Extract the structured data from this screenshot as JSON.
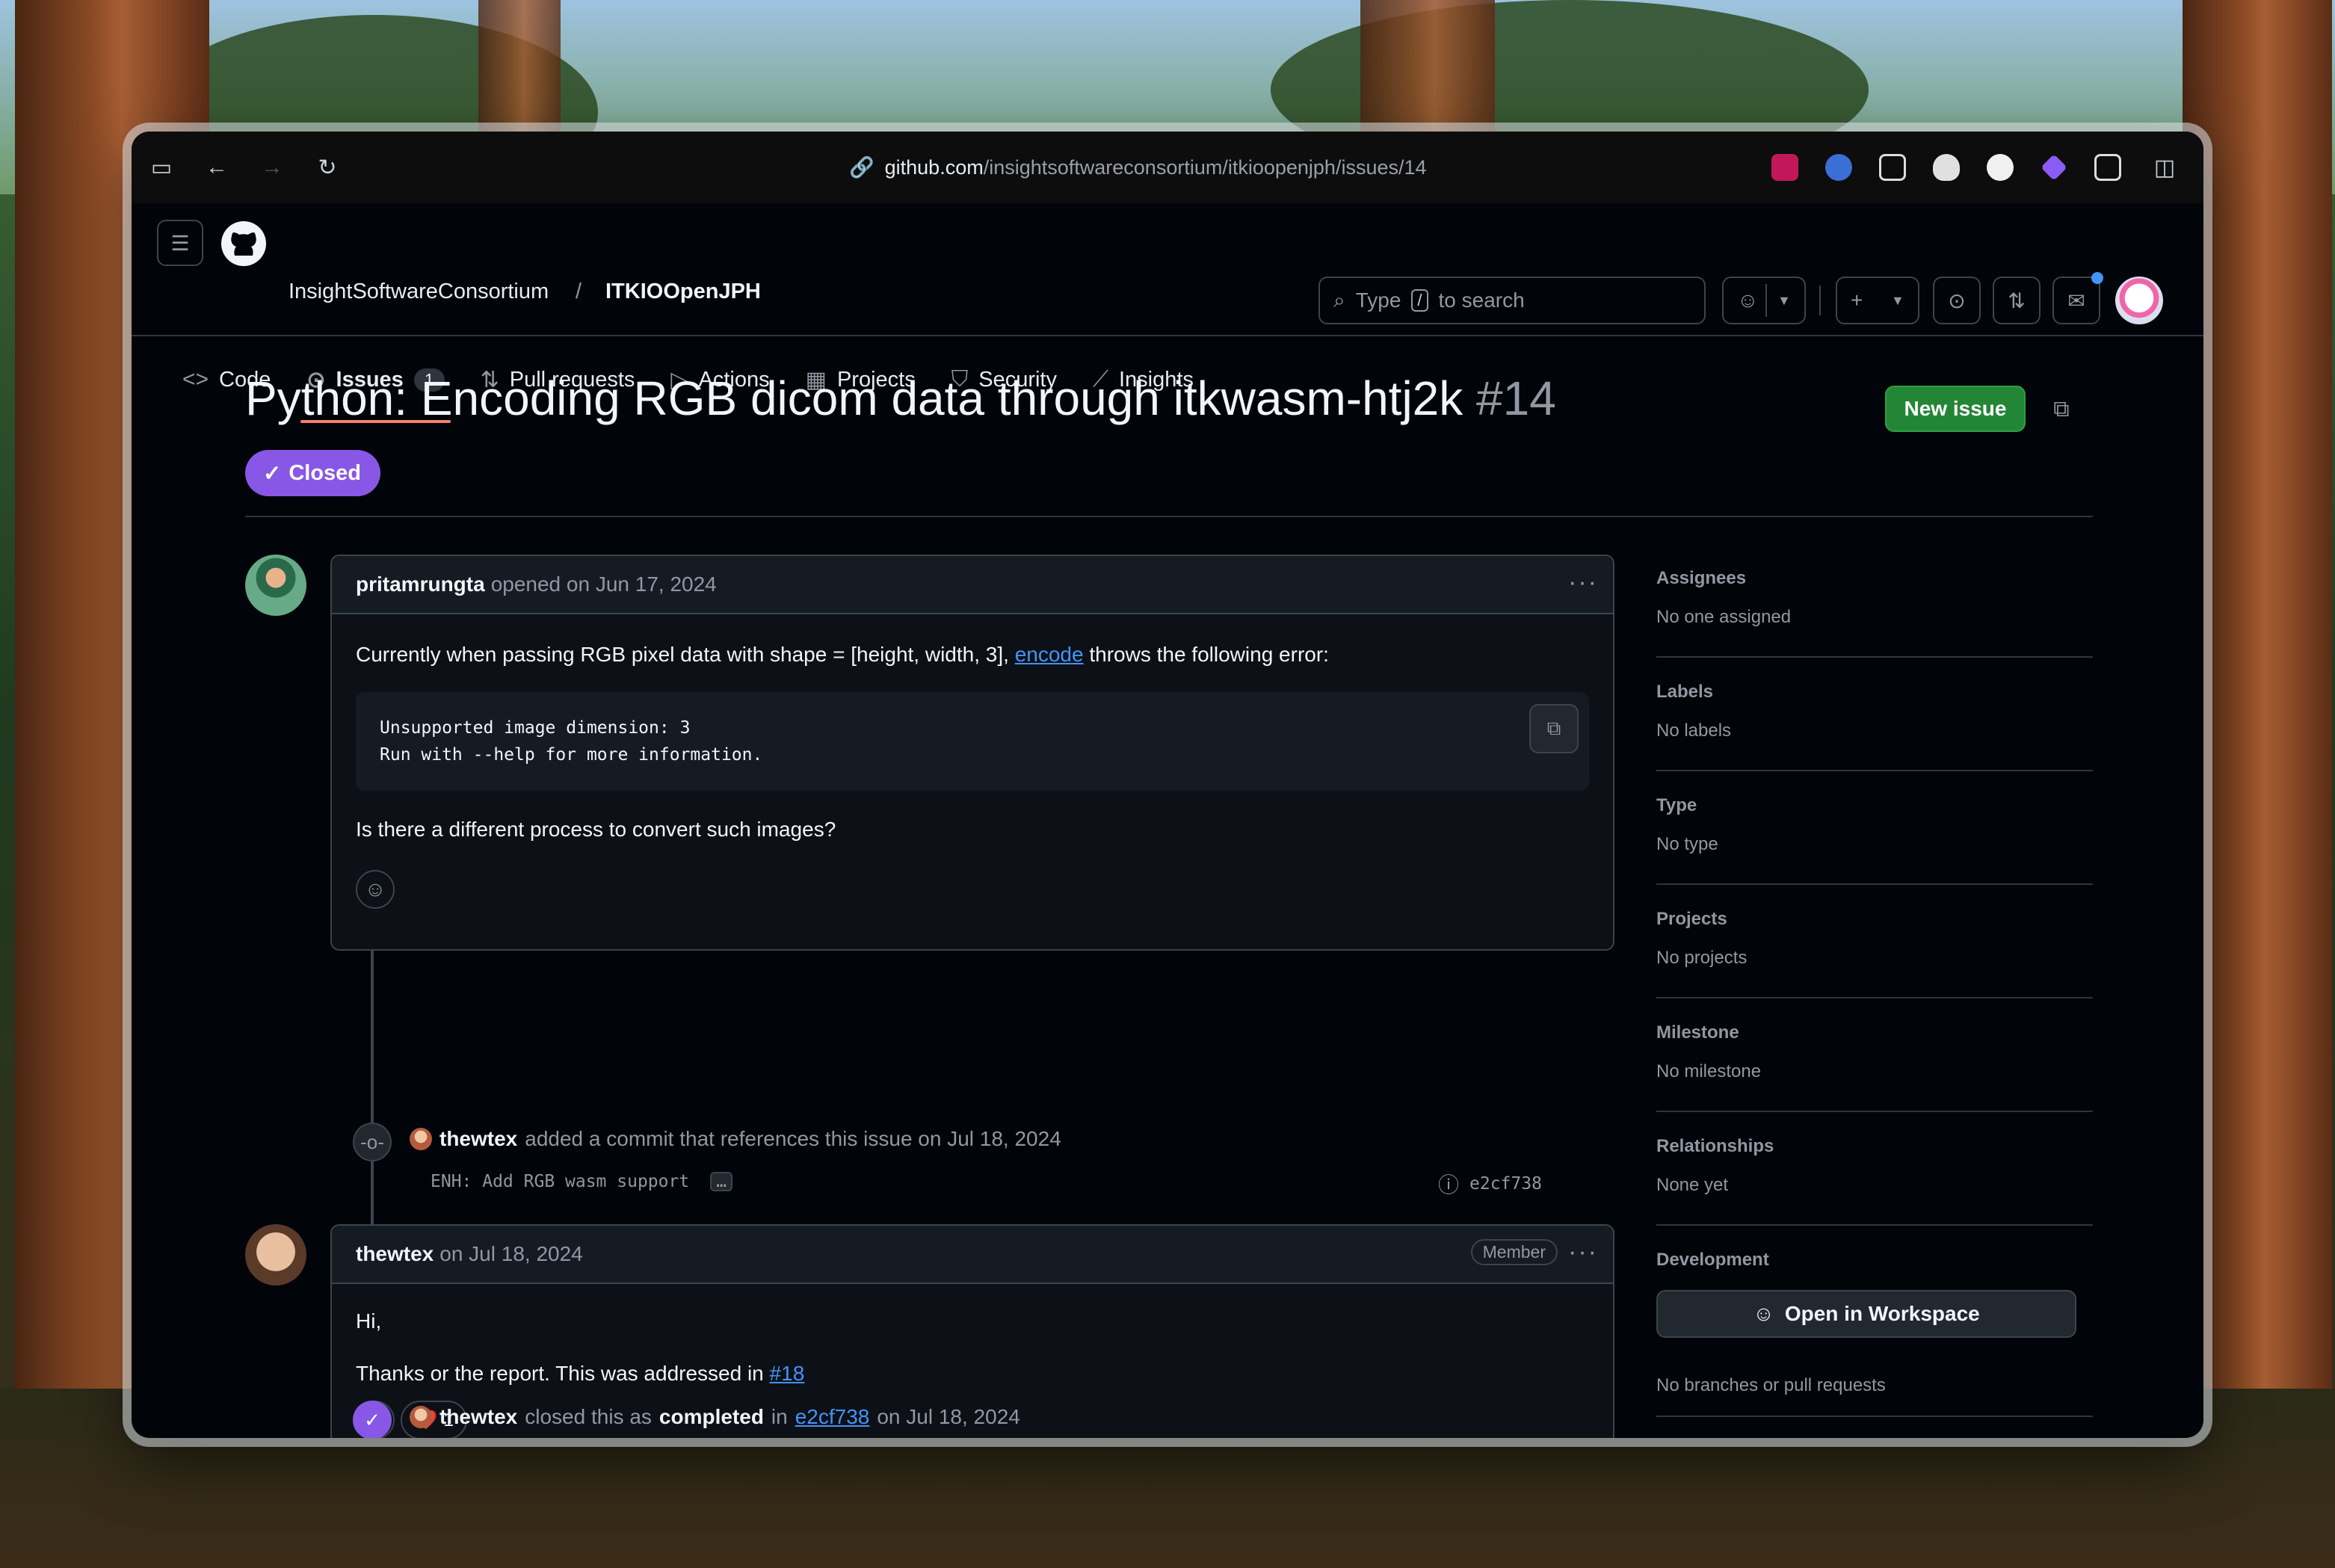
{
  "browser": {
    "url_host": "github.com",
    "url_path": "/insightsoftwareconsortium/itkioopenjph/issues/14"
  },
  "header": {
    "owner": "InsightSoftwareConsortium",
    "separator": "/",
    "repo": "ITKIOOpenJPH",
    "search_prefix": "Type",
    "search_key": "/",
    "search_suffix": "to search"
  },
  "tabs": [
    {
      "label": "Code",
      "icon": "code-icon"
    },
    {
      "label": "Issues",
      "icon": "issue-icon",
      "count": "1"
    },
    {
      "label": "Pull requests",
      "icon": "pull-request-icon"
    },
    {
      "label": "Actions",
      "icon": "play-icon"
    },
    {
      "label": "Projects",
      "icon": "table-icon"
    },
    {
      "label": "Security",
      "icon": "shield-icon"
    },
    {
      "label": "Insights",
      "icon": "graph-icon"
    }
  ],
  "issue": {
    "title": "Python: Encoding RGB dicom data through itkwasm-htj2k",
    "number": "#14",
    "state": "Closed",
    "new_issue_label": "New issue"
  },
  "comment1": {
    "author": "pritamrungta",
    "meta": "opened on Jun 17, 2024",
    "text_before": "Currently when passing RGB pixel data with shape = [height, width, 3],",
    "link": "encode",
    "text_after": "throws the following error:",
    "code_line1": "Unsupported image dimension: 3",
    "code_line2": "Run with --help for more information.",
    "question": "Is there a different process to convert such images?"
  },
  "event_commit": {
    "author": "thewtex",
    "text": "added a commit that references this issue on Jul 18, 2024",
    "message": "ENH: Add RGB wasm support",
    "more": "…",
    "sha": "e2cf738"
  },
  "comment2": {
    "author": "thewtex",
    "meta": "on Jul 18, 2024",
    "badge": "Member",
    "greeting": "Hi,",
    "text": "Thanks or the report. This was addressed in",
    "link": "#18",
    "reaction_emoji": "❤️",
    "reaction_count": "1"
  },
  "event_closed": {
    "author": "thewtex",
    "text1": "closed this as",
    "status": "completed",
    "text2": "in",
    "sha": "e2cf738",
    "date": "on Jul 18, 2024"
  },
  "sidebar": {
    "assignees_h": "Assignees",
    "assignees_v": "No one assigned",
    "labels_h": "Labels",
    "labels_v": "No labels",
    "type_h": "Type",
    "type_v": "No type",
    "projects_h": "Projects",
    "projects_v": "No projects",
    "milestone_h": "Milestone",
    "milestone_v": "No milestone",
    "relationships_h": "Relationships",
    "relationships_v": "None yet",
    "development_h": "Development",
    "workspace_btn": "Open in Workspace",
    "development_v": "No branches or pull requests"
  },
  "colors": {
    "closed_purple": "#8957e5",
    "new_issue_green": "#238636",
    "link_blue": "#4493f8",
    "tab_underline": "#f78166"
  }
}
